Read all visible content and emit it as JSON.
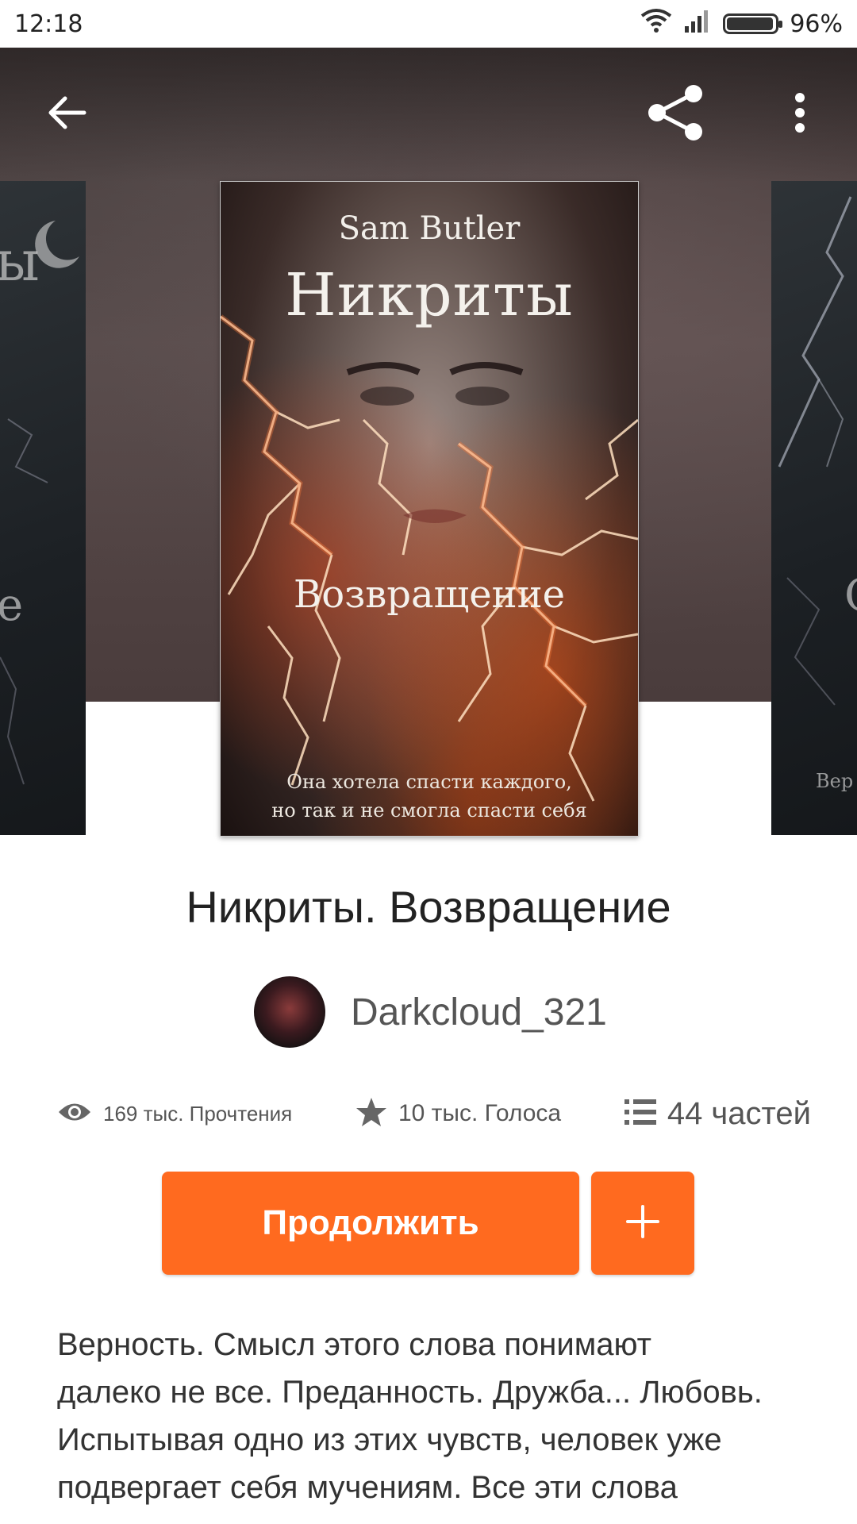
{
  "status_bar": {
    "time": "12:18",
    "battery_percent": "96%",
    "battery_level": 0.96
  },
  "toolbar": {
    "back_icon": "arrow-left-icon",
    "share_icon": "share-icon",
    "more_icon": "more-vertical-icon"
  },
  "cover": {
    "author": "Sam Butler",
    "title": "Никриты",
    "subtitle": "Возвращение",
    "tagline_line1": "Она хотела спасти каждого,",
    "tagline_line2": "но так и не смогла спасти себя"
  },
  "side_covers": {
    "left_fragment_1": "ы",
    "left_fragment_2": "e",
    "right_fragment_1": "С",
    "right_fragment_2": "Вер"
  },
  "book": {
    "title": "Никриты. Возвращение",
    "author": "Darkcloud_321"
  },
  "stats": {
    "reads": "169 тыс. Прочтения",
    "votes": "10 тыс. Голоса",
    "parts": "44 частей",
    "reads_icon": "eye-icon",
    "votes_icon": "star-icon",
    "parts_icon": "list-icon"
  },
  "actions": {
    "continue_label": "Продолжить",
    "add_icon": "plus-icon"
  },
  "description": {
    "line1": "Верность. Смысл этого слова понимают",
    "line2": "далеко не все. Преданность. Дружба... Любовь.",
    "line3": "Испытывая одно из этих чувств, человек уже",
    "line4": "подвергает себя мучениям. Все эти слова"
  },
  "colors": {
    "accent": "#ff6a1f",
    "text_primary": "#222222",
    "text_secondary": "#555555"
  }
}
